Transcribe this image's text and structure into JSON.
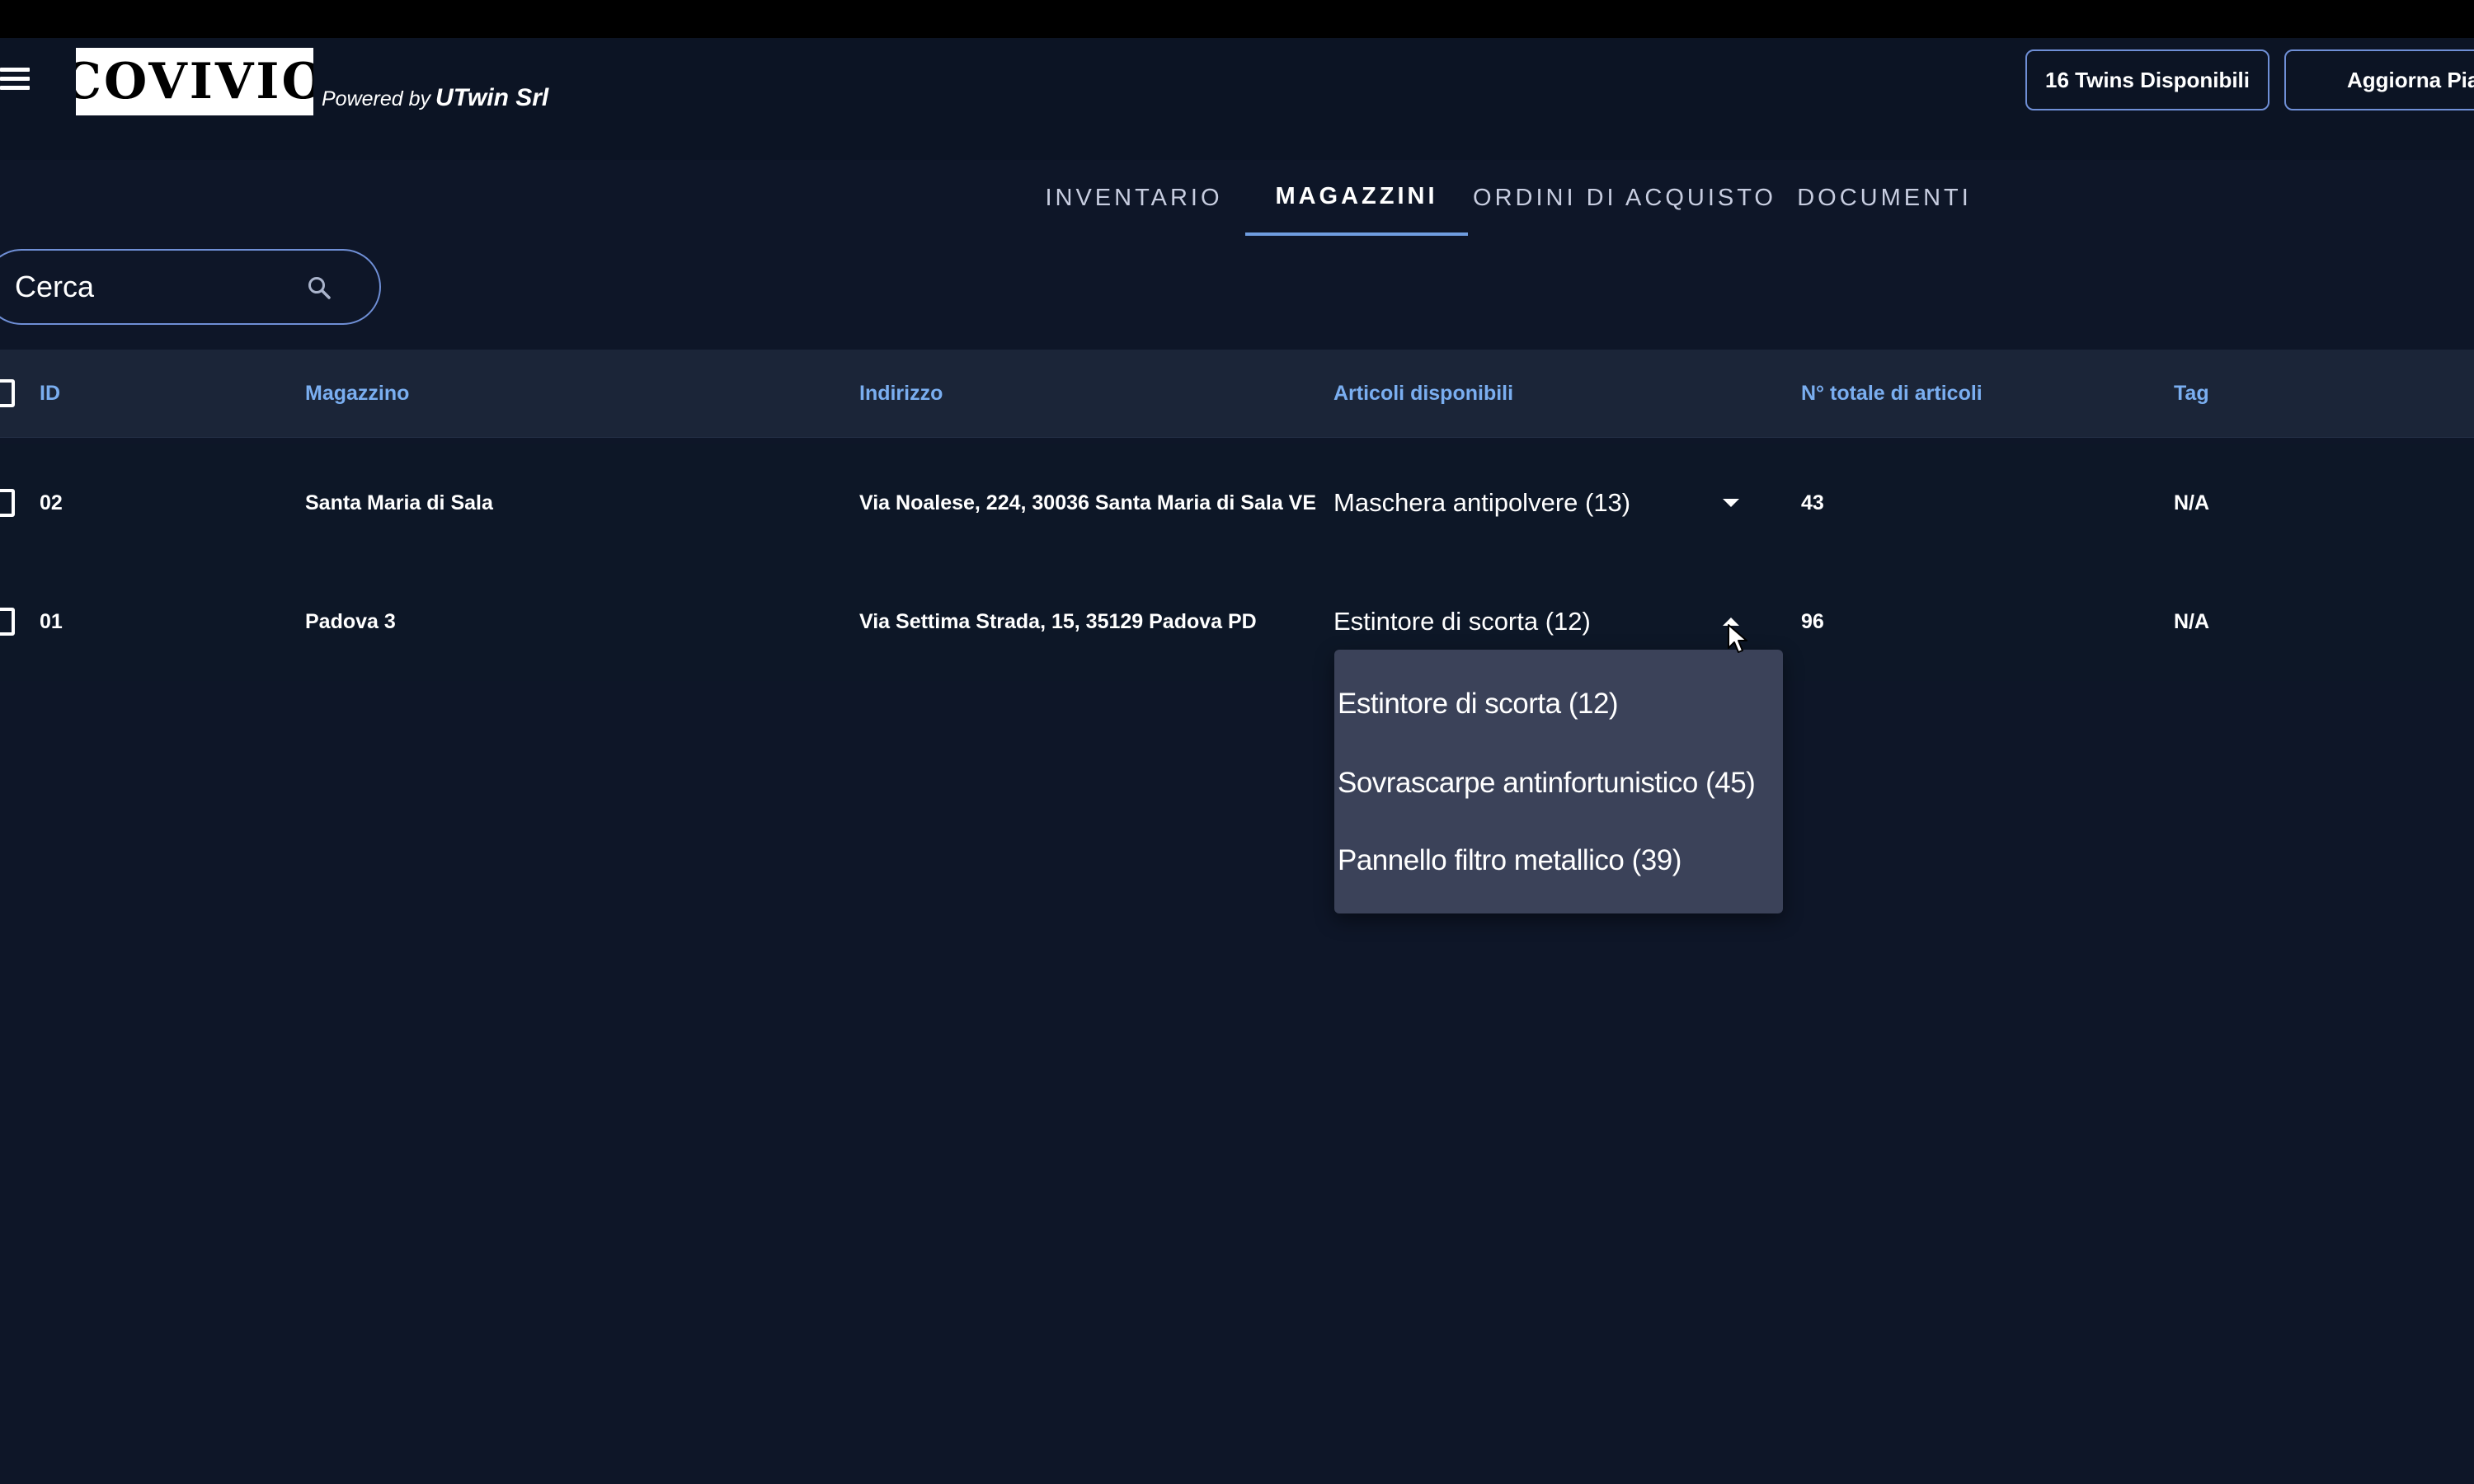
{
  "header": {
    "logo_text": "COVIVIO",
    "powered_by_prefix": "Powered by",
    "powered_by_name": "UTwin Srl",
    "twins_button": "16 Twins Disponibili",
    "update_button": "Aggiorna Pia"
  },
  "tabs": [
    {
      "label": "INVENTARIO",
      "active": false
    },
    {
      "label": "MAGAZZINI",
      "active": true
    },
    {
      "label": "ORDINI DI ACQUISTO",
      "active": false
    },
    {
      "label": "DOCUMENTI",
      "active": false
    }
  ],
  "search": {
    "placeholder": "Cerca"
  },
  "table": {
    "columns": [
      "ID",
      "Magazzino",
      "Indirizzo",
      "Articoli disponibili",
      "N° totale di articoli",
      "Tag"
    ],
    "rows": [
      {
        "id": "02",
        "magazzino": "Santa Maria di Sala",
        "indirizzo": "Via Noalese, 224, 30036 Santa Maria di Sala VE",
        "articoli": "Maschera antipolvere (13)",
        "totale": "43",
        "tag": "N/A",
        "expanded": false
      },
      {
        "id": "01",
        "magazzino": "Padova 3",
        "indirizzo": "Via Settima Strada, 15, 35129 Padova PD",
        "articoli": "Estintore di scorta (12)",
        "totale": "96",
        "tag": "N/A",
        "expanded": true
      }
    ]
  },
  "dropdown": {
    "items": [
      "Estintore di scorta (12)",
      "Sovrascarpe antinfortunistico (45)",
      "Pannello filtro metallico (39)"
    ]
  },
  "colors": {
    "background": "#0e1628",
    "header_bg": "#0c1424",
    "accent": "#6f8fd6",
    "column_header_text": "#7aaef0",
    "dropdown_bg": "#3b4259"
  }
}
